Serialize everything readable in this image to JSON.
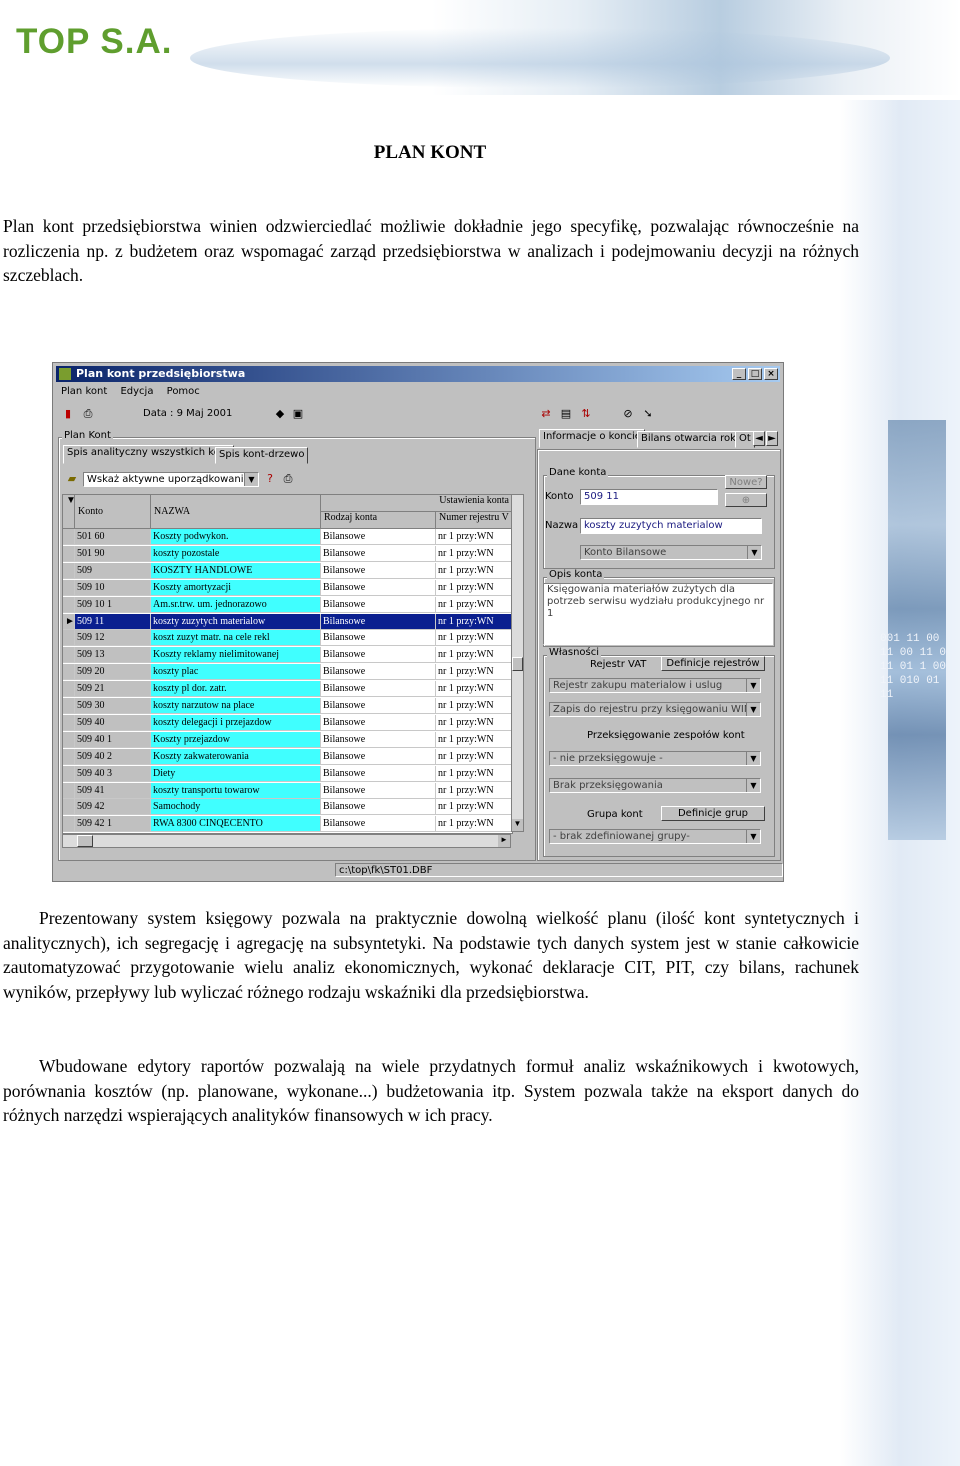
{
  "header": {
    "logo": "TOP S.A."
  },
  "decor": {
    "code_text": "001 11 00 11 00 11 0 11 01 1 00 11 010 01 11"
  },
  "doc": {
    "title": "PLAN KONT",
    "para1": "Plan kont przedsiębiorstwa winien odzwierciedlać możliwie dokładnie jego specyfikę, pozwalając równocześnie na rozliczenia np. z budżetem oraz wspomagać zarząd przedsiębiorstwa w analizach i podejmowaniu decyzji na różnych szczeblach.",
    "para2": "Prezentowany system księgowy pozwala na praktycznie dowolną wielkość planu (ilość kont syntetycznych i analitycznych), ich segregację i agregację na subsyntetyki. Na podstawie tych danych system jest w stanie całkowicie zautomatyzować przygotowanie wielu analiz ekonomicznych, wykonać deklaracje CIT, PIT, czy bilans, rachunek wyników, przepływy lub wyliczać różnego rodzaju wskaźniki dla przedsiębiorstwa.",
    "para3": "Wbudowane edytory raportów pozwalają na wiele przydatnych formuł analiz wskaźnikowych i kwotowych, porównania kosztów (np. planowane, wykonane...) budżetowania itp. System pozwala także na eksport danych do różnych narzędzi wspierających analityków finansowych w ich pracy."
  },
  "window": {
    "title": "Plan kont przedsiębiorstwa",
    "menu": [
      "Plan kont",
      "Edycja",
      "Pomoc"
    ],
    "date": "Data : 9 Maj 2001",
    "plan_group": "Plan Kont",
    "tabs_left": [
      "Spis analityczny wszystkich kont",
      "Spis kont-drzewo"
    ],
    "filter": "Wskaż aktywne uporządkowanie",
    "grid_headers": {
      "konto": "Konto",
      "nazwa": "NAZWA",
      "ustawienia": "Ustawienia konta",
      "rodzaj": "Rodzaj konta",
      "numer": "Numer rejestru V"
    },
    "rows": [
      {
        "konto": "501 60",
        "nazwa": "Koszty podwykon.",
        "rodzaj": "Bilansowe",
        "nr": "nr 1 przy:WN"
      },
      {
        "konto": "501 90",
        "nazwa": "koszty pozostale",
        "rodzaj": "Bilansowe",
        "nr": "nr 1 przy:WN"
      },
      {
        "konto": "509",
        "nazwa": "KOSZTY HANDLOWE",
        "rodzaj": "Bilansowe",
        "nr": "nr 1 przy:WN"
      },
      {
        "konto": "509 10",
        "nazwa": "Koszty amortyzacji",
        "rodzaj": "Bilansowe",
        "nr": "nr 1 przy:WN"
      },
      {
        "konto": "509 10 1",
        "nazwa": "Am.sr.trw. um. jednorazowo",
        "rodzaj": "Bilansowe",
        "nr": "nr 1 przy:WN"
      },
      {
        "konto": "509 11",
        "nazwa": "koszty zuzytych materialow",
        "rodzaj": "Bilansowe",
        "nr": "nr 1 przy:WN",
        "selected": true
      },
      {
        "konto": "509 12",
        "nazwa": "koszt zuzyt matr. na cele rekl",
        "rodzaj": "Bilansowe",
        "nr": "nr 1 przy:WN"
      },
      {
        "konto": "509 13",
        "nazwa": "Koszty reklamy nielimitowanej",
        "rodzaj": "Bilansowe",
        "nr": "nr 1 przy:WN"
      },
      {
        "konto": "509 20",
        "nazwa": "koszty plac",
        "rodzaj": "Bilansowe",
        "nr": "nr 1 przy:WN"
      },
      {
        "konto": "509 21",
        "nazwa": "koszty pl dor. zatr.",
        "rodzaj": "Bilansowe",
        "nr": "nr 1 przy:WN"
      },
      {
        "konto": "509 30",
        "nazwa": "koszty narzutow na place",
        "rodzaj": "Bilansowe",
        "nr": "nr 1 przy:WN"
      },
      {
        "konto": "509 40",
        "nazwa": "koszty delegacji i przejazdow",
        "rodzaj": "Bilansowe",
        "nr": "nr 1 przy:WN"
      },
      {
        "konto": "509 40 1",
        "nazwa": "Koszty przejazdow",
        "rodzaj": "Bilansowe",
        "nr": "nr 1 przy:WN"
      },
      {
        "konto": "509 40 2",
        "nazwa": "Koszty zakwaterowania",
        "rodzaj": "Bilansowe",
        "nr": "nr 1 przy:WN"
      },
      {
        "konto": "509 40 3",
        "nazwa": "Diety",
        "rodzaj": "Bilansowe",
        "nr": "nr 1 przy:WN"
      },
      {
        "konto": "509 41",
        "nazwa": "koszty transportu towarow",
        "rodzaj": "Bilansowe",
        "nr": "nr 1 przy:WN"
      },
      {
        "konto": "509 42",
        "nazwa": "Samochody",
        "rodzaj": "Bilansowe",
        "nr": "nr 1 przy:WN"
      },
      {
        "konto": "509 42 1",
        "nazwa": "RWA 8300 CINQECENTO",
        "rodzaj": "Bilansowe",
        "nr": "nr 1 przy:WN"
      }
    ],
    "tabs_right": [
      "Informacje o koncie",
      "Bilans otwarcia roku",
      "Ot"
    ],
    "dane_konta": "Dane konta",
    "konto_label": "Konto",
    "konto_value": "509 11",
    "nowe_button": "Nowe?",
    "nazwa_label": "Nazwa",
    "nazwa_value": "koszty zuzytych materialow",
    "konto_type": "Konto Bilansowe",
    "opis_group": "Opis konta",
    "opis_text": "Księgowania materiałów zużytych dla potrzeb serwisu wydziału produkcyjnego nr 1",
    "wlasnosci_group": "Własności",
    "rejestr_vat": "Rejestr VAT",
    "definicje_rejestrow": "Definicje rejestrów",
    "rejestr_combo": "Rejestr zakupu materialow i uslug",
    "zapis_combo": "Zapis do rejestru przy księgowaniu WINIEN",
    "przeksiegowanie_label": "Przeksięgowanie zespołów kont",
    "nie_przeksiegowuje": "- nie przeksięgowuje -",
    "brak_przeksiegowania": "Brak przeksięgowania",
    "grupa_konto": "Grupa kont",
    "definicje_grup": "Definicje grup",
    "brak_grupy": "- brak zdefiniowanej grupy-",
    "status_path": "c:\\top\\fk\\ST01.DBF"
  }
}
